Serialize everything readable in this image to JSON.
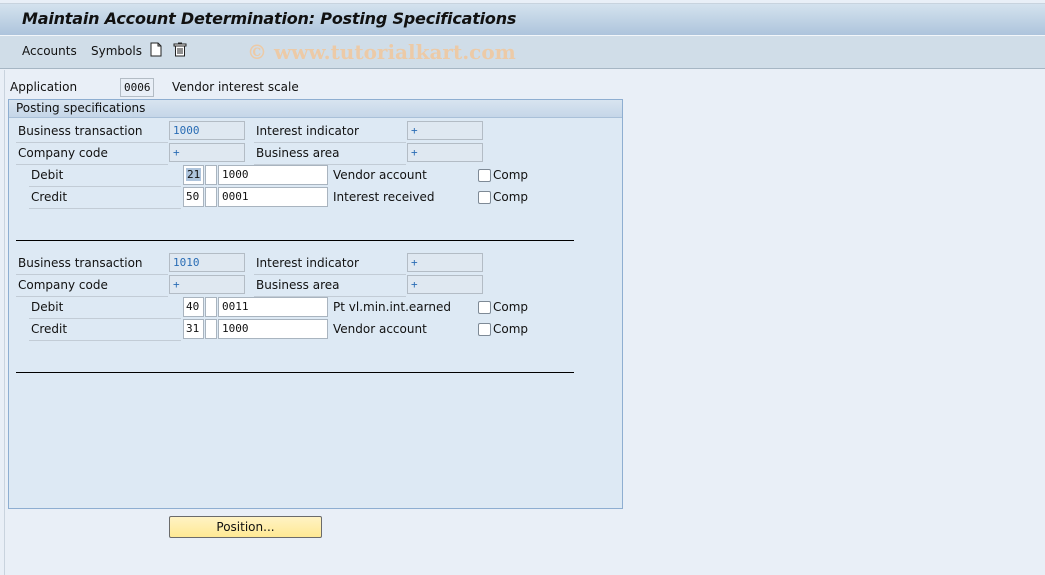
{
  "window": {
    "title": "Maintain Account Determination: Posting Specifications"
  },
  "toolbar": {
    "menus": [
      "Accounts",
      "Symbols"
    ],
    "icons": [
      "new-document-icon",
      "trash-icon"
    ],
    "watermark": "© www.tutorialkart.com"
  },
  "header": {
    "application_label": "Application",
    "application_value": "0006",
    "application_desc": "Vendor interest scale"
  },
  "group": {
    "title": "Posting specifications",
    "labels": {
      "business_transaction": "Business transaction",
      "interest_indicator": "Interest indicator",
      "company_code": "Company code",
      "business_area": "Business area",
      "debit": "Debit",
      "credit": "Credit",
      "comp": "Comp"
    },
    "blocks": [
      {
        "business_transaction": "1000",
        "interest_indicator": "+",
        "company_code": "+",
        "business_area": "+",
        "debit": {
          "posting_key": "21",
          "special_gl": "",
          "account": "1000",
          "description": "Vendor account",
          "comp_checked": false
        },
        "credit": {
          "posting_key": "50",
          "special_gl": "",
          "account": "0001",
          "description": "Interest received",
          "comp_checked": false
        }
      },
      {
        "business_transaction": "1010",
        "interest_indicator": "+",
        "company_code": "+",
        "business_area": "+",
        "debit": {
          "posting_key": "40",
          "special_gl": "",
          "account": "0011",
          "description": "Pt vl.min.int.earned",
          "comp_checked": false
        },
        "credit": {
          "posting_key": "31",
          "special_gl": "",
          "account": "1000",
          "description": "Vendor account",
          "comp_checked": false
        }
      }
    ]
  },
  "buttons": {
    "position": "Position..."
  }
}
